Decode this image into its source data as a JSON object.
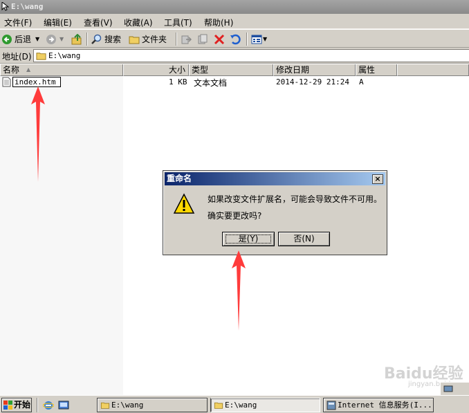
{
  "window": {
    "title": "E:\\wang"
  },
  "menu": [
    {
      "label": "文件(F)"
    },
    {
      "label": "编辑(E)"
    },
    {
      "label": "查看(V)"
    },
    {
      "label": "收藏(A)"
    },
    {
      "label": "工具(T)"
    },
    {
      "label": "帮助(H)"
    }
  ],
  "toolbar": {
    "back_label": "后退",
    "search_label": "搜索",
    "folders_label": "文件夹"
  },
  "address": {
    "label": "地址(D)",
    "value": "E:\\wang"
  },
  "columns": [
    "名称",
    "大小",
    "类型",
    "修改日期",
    "属性"
  ],
  "files": [
    {
      "name": "index.htm",
      "size": "1 KB",
      "type": "文本文档",
      "modified": "2014-12-29 21:24",
      "attr": "A"
    }
  ],
  "dialog": {
    "title": "重命名",
    "close": "×",
    "message_line1": "如果改变文件扩展名，可能会导致文件不可用。",
    "message_line2": "确实要更改吗?",
    "yes_label": "是(Y)",
    "no_label": "否(N)"
  },
  "taskbar": {
    "start_label": "开始",
    "tasks": [
      {
        "label": "E:\\wang"
      },
      {
        "label": "E:\\wang"
      },
      {
        "label": "Internet 信息服务(I..."
      }
    ]
  },
  "watermark": {
    "brand": "Baidu经验",
    "sub": "jingyan.baidu.com"
  },
  "colors": {
    "dialog_title_start": "#0a246a",
    "dialog_title_end": "#a6caf0",
    "arrow": "#ff3b3b"
  }
}
